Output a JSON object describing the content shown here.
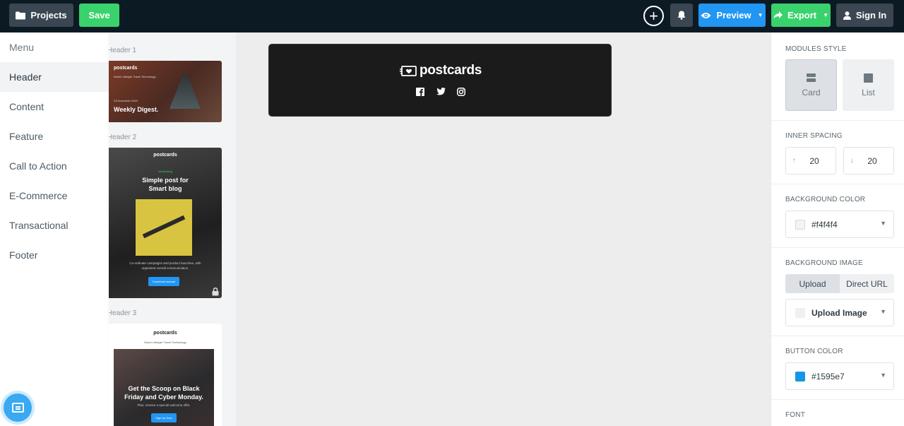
{
  "toolbar": {
    "projects_label": "Projects",
    "save_label": "Save",
    "preview_label": "Preview",
    "export_label": "Export",
    "signin_label": "Sign In"
  },
  "menu": {
    "items": [
      {
        "label": "Menu"
      },
      {
        "label": "Header"
      },
      {
        "label": "Content"
      },
      {
        "label": "Feature"
      },
      {
        "label": "Call to Action"
      },
      {
        "label": "E-Commerce"
      },
      {
        "label": "Transactional"
      },
      {
        "label": "Footer"
      }
    ],
    "active": "Header"
  },
  "thumbnails": {
    "items": [
      {
        "label": "Header 1",
        "logo": "postcards",
        "nav": "World  Lifestyle  Travel  Technology",
        "date": "23 November 2019",
        "title": "Weekly Digest."
      },
      {
        "label": "Header 2",
        "logo": "postcards",
        "intro": "Introducing",
        "title_line1": "Simple post for",
        "title_line2": "Smart blog",
        "desc": "Co-ordinate campaigns and product launches, with organised overall communication.",
        "button": "Download manual",
        "locked": true
      },
      {
        "label": "Header 3",
        "logo": "postcards",
        "nav": "World  Lifestyle  Travel  Technology",
        "title_line1": "Get the Scoop on Black",
        "title_line2": "Friday and Cyber Monday.",
        "sub": "Plus, receive a special welcome offer.",
        "button": "Sign Up Now"
      }
    ]
  },
  "canvas": {
    "header_module": {
      "logo": "postcards",
      "social": [
        "facebook-icon",
        "twitter-icon",
        "instagram-icon"
      ]
    }
  },
  "settings": {
    "modules_style": {
      "title": "MODULES STYLE",
      "options": [
        "Card",
        "List"
      ],
      "selected": "Card"
    },
    "inner_spacing": {
      "title": "INNER SPACING",
      "top": "20",
      "bottom": "20"
    },
    "background_color": {
      "title": "BACKGROUND COLOR",
      "value": "#f4f4f4"
    },
    "background_image": {
      "title": "BACKGROUND IMAGE",
      "tabs": [
        "Upload",
        "Direct URL"
      ],
      "selected_tab": "Upload",
      "upload_label": "Upload Image"
    },
    "button_color": {
      "title": "BUTTON COLOR",
      "value": "#1595e7"
    },
    "font": {
      "title": "FONT"
    }
  },
  "colors": {
    "topbar": "#0c1a24",
    "accent_green": "#39d26c",
    "accent_blue": "#2196f3"
  }
}
